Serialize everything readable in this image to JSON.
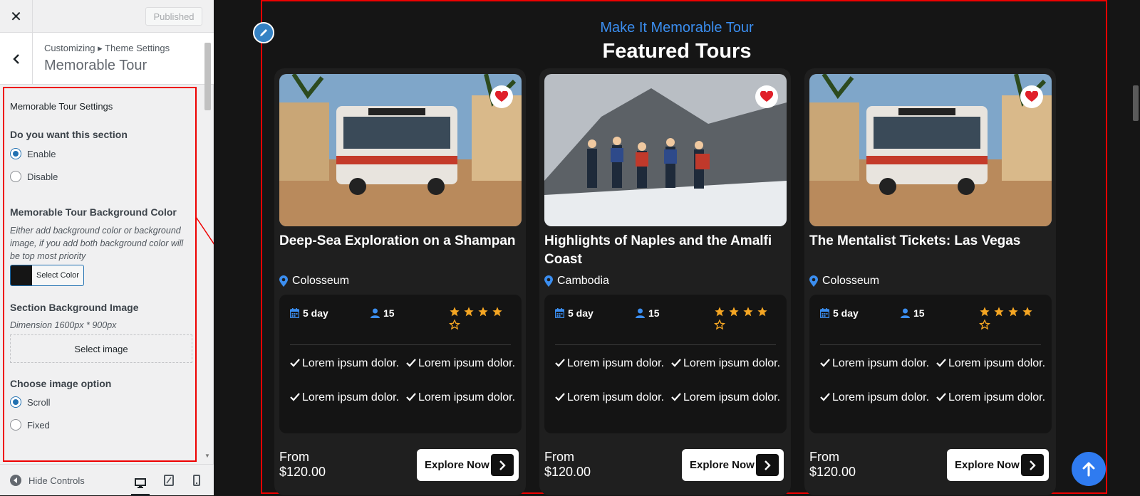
{
  "customizer": {
    "close_icon": "close-icon",
    "publish_label": "Published",
    "breadcrumb": "Customizing ▸ Theme Settings",
    "section_title": "Memorable Tour",
    "controls": {
      "heading": "Memorable Tour Settings",
      "enable_question": "Do you want this section",
      "enable_options": [
        "Enable",
        "Disable"
      ],
      "enable_selected": "Enable",
      "bg_color_label": "Memorable Tour Background Color",
      "bg_color_desc": "Either add background color or background image, if you add both background color will be top most priority",
      "bg_color_value": "#151515",
      "select_color_label": "Select Color",
      "bg_image_label": "Section Background Image",
      "bg_image_desc": "Dimension 1600px * 900px",
      "select_image_label": "Select image",
      "image_option_label": "Choose image option",
      "image_options": [
        "Scroll",
        "Fixed"
      ],
      "image_option_selected": "Scroll"
    },
    "footer": {
      "hide_controls_label": "Hide Controls",
      "devices": [
        "desktop",
        "tablet",
        "mobile"
      ],
      "active_device": "desktop"
    }
  },
  "preview": {
    "subtitle": "Make It Memorable Tour",
    "title": "Featured Tours",
    "accent_color": "#3b8ef0",
    "star_color": "#f5a623",
    "tours": [
      {
        "title": "Deep-Sea Exploration on a Shampan",
        "image": "bus-street-image",
        "location": "Colosseum",
        "duration": "5 day",
        "people": "15",
        "rating": 4,
        "features": [
          "Lorem ipsum dolor.",
          "Lorem ipsum dolor.",
          "Lorem ipsum dolor.",
          "Lorem ipsum dolor."
        ],
        "price_label": "From",
        "price": "$120.00",
        "button_label": "Explore Now"
      },
      {
        "title": "Highlights of Naples and the Amalfi Coast",
        "image": "mountain-climbers-image",
        "location": "Cambodia",
        "duration": "5 day",
        "people": "15",
        "rating": 4,
        "features": [
          "Lorem ipsum dolor.",
          "Lorem ipsum dolor.",
          "Lorem ipsum dolor.",
          "Lorem ipsum dolor."
        ],
        "price_label": "From",
        "price": "$120.00",
        "button_label": "Explore Now"
      },
      {
        "title": "The Mentalist Tickets: Las Vegas",
        "image": "bus-street-image",
        "location": "Colosseum",
        "duration": "5 day",
        "people": "15",
        "rating": 4,
        "features": [
          "Lorem ipsum dolor.",
          "Lorem ipsum dolor.",
          "Lorem ipsum dolor.",
          "Lorem ipsum dolor."
        ],
        "price_label": "From",
        "price": "$120.00",
        "button_label": "Explore Now"
      }
    ]
  }
}
